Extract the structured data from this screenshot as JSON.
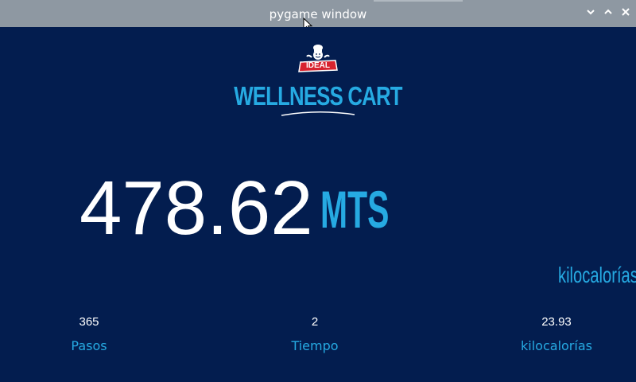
{
  "window": {
    "title": "pygame window"
  },
  "icons": {
    "minimize": "chevron-down-icon",
    "maximize": "chevron-up-icon",
    "close": "close-icon",
    "cursor": "arrow-cursor-icon",
    "logo": "ideal-chef-logo-icon"
  },
  "brand": {
    "logo_text": "IDEAL",
    "name": "WELLNESS CART"
  },
  "distance": {
    "value": "478.62",
    "unit": "MTS"
  },
  "side_label": "kilocalorías",
  "stats": [
    {
      "value": "365",
      "label": "Pasos"
    },
    {
      "value": "2",
      "label": "Tiempo"
    },
    {
      "value": "23.93",
      "label": "kilocalorías"
    }
  ],
  "colors": {
    "background": "#031d4f",
    "titlebar": "#8e98a2",
    "accent": "#26aae2",
    "text": "#ffffff",
    "logo_red": "#d7232e"
  }
}
